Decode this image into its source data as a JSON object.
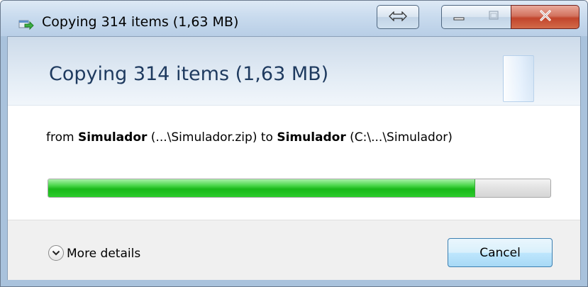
{
  "window": {
    "title": "Copying 314 items (1,63 MB)"
  },
  "titlebar": {
    "resize_icon": "resize-arrows-icon",
    "minimize_icon": "minimize-icon",
    "maximize_icon": "maximize-icon",
    "close_icon": "close-icon"
  },
  "header": {
    "title": "Copying 314 items (1,63 MB)"
  },
  "transfer": {
    "from_prefix": "from ",
    "source_name": "Simulador",
    "source_path": " (...\\Simulador.zip) to ",
    "dest_name": "Simulador",
    "dest_path": " (C:\\...\\Simulador)"
  },
  "progress": {
    "fraction": 0.85
  },
  "footer": {
    "more_details_label": "More details",
    "more_details_icon": "chevron-down-circle-icon",
    "cancel_label": "Cancel"
  },
  "colors": {
    "progress_green": "#19b819",
    "header_text": "#1e3a5f",
    "close_red": "#c2452c",
    "button_border": "#3c7fb1"
  }
}
